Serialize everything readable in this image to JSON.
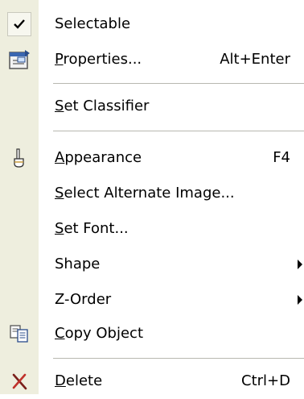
{
  "menu": {
    "items": [
      {
        "label": "Selectable",
        "mnemonic": "",
        "rest": "",
        "shortcut": "",
        "icon": "checkmark-icon",
        "checked": true
      },
      {
        "label": "",
        "mnemonic": "P",
        "rest": "roperties...",
        "shortcut": "Alt+Enter",
        "icon": "properties-icon"
      },
      {
        "label": "",
        "mnemonic": "S",
        "rest": "et Classifier",
        "shortcut": "",
        "icon": ""
      },
      {
        "label": "",
        "mnemonic": "A",
        "rest": "ppearance",
        "shortcut": "F4",
        "icon": "paint-brush-icon"
      },
      {
        "label": "",
        "mnemonic": "S",
        "rest": "elect Alternate Image...",
        "shortcut": "",
        "icon": ""
      },
      {
        "label": "",
        "mnemonic": "S",
        "rest": "et Font...",
        "shortcut": "",
        "icon": ""
      },
      {
        "label": "Shape",
        "mnemonic": "",
        "rest": "",
        "shortcut": "",
        "icon": "",
        "submenu": true
      },
      {
        "label": "Z-Order",
        "mnemonic": "",
        "rest": "",
        "shortcut": "",
        "icon": "",
        "submenu": true
      },
      {
        "label": "",
        "mnemonic": "C",
        "rest": "opy Object",
        "shortcut": "",
        "icon": "copy-icon"
      },
      {
        "label": "",
        "mnemonic": "D",
        "rest": "elete",
        "shortcut": "Ctrl+D",
        "icon": "delete-x-icon"
      }
    ]
  },
  "colors": {
    "gutter": "#eeeede",
    "menu_background": "#ffffff",
    "separator": "#b8b8b0",
    "text": "#000000",
    "delete_icon": "#c0312b"
  }
}
